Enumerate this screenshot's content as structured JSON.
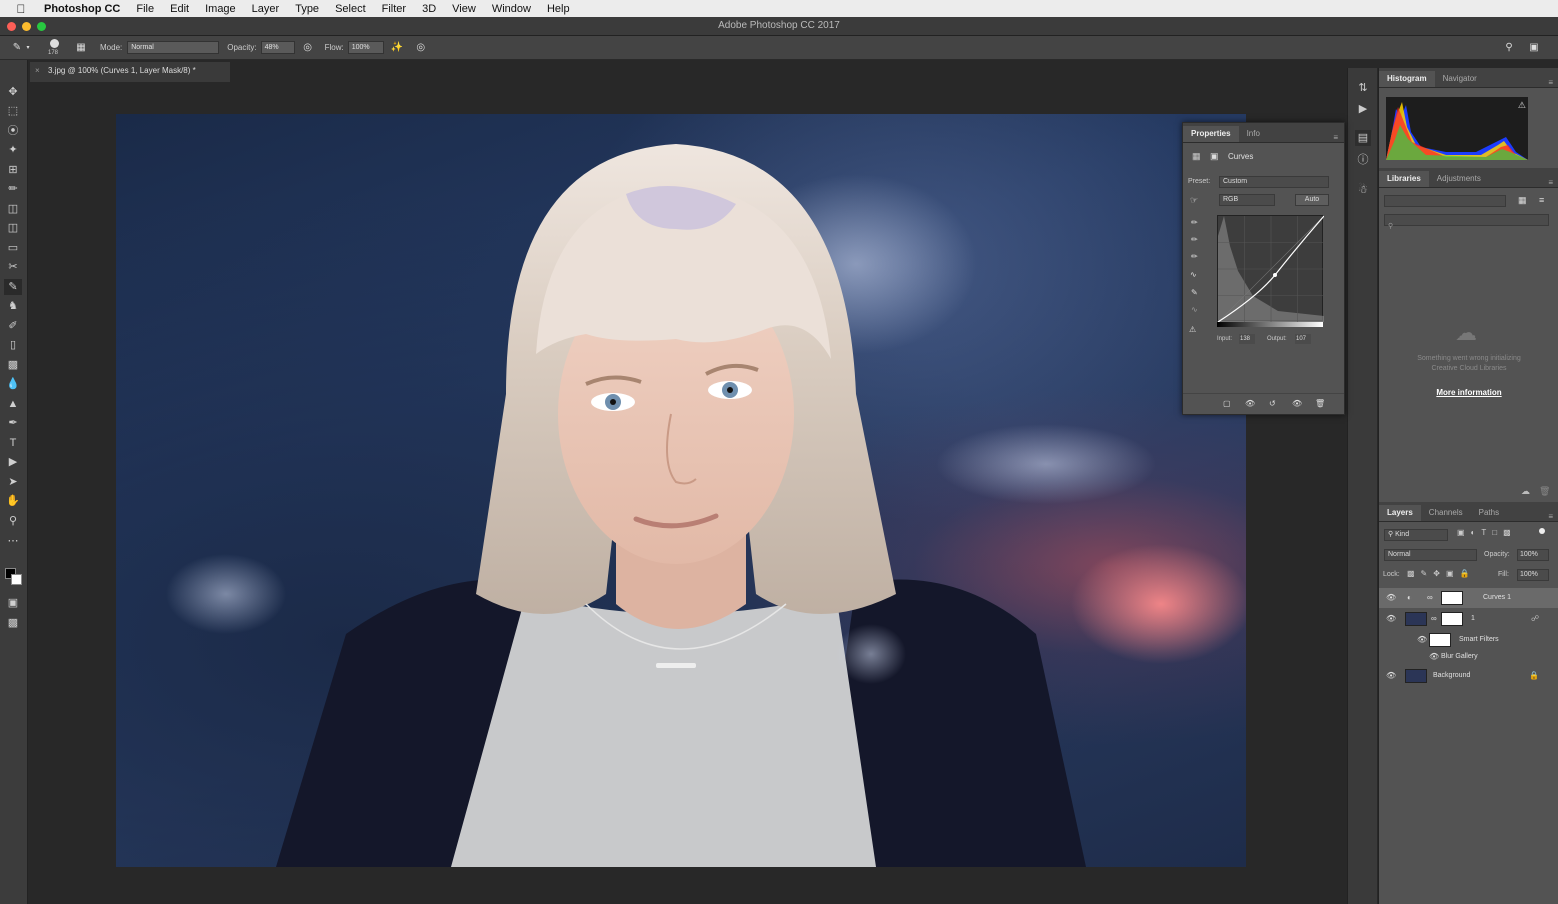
{
  "menubar": {
    "app": "Photoshop CC",
    "items": [
      "File",
      "Edit",
      "Image",
      "Layer",
      "Type",
      "Select",
      "Filter",
      "3D",
      "View",
      "Window",
      "Help"
    ]
  },
  "window": {
    "title": "Adobe Photoshop CC 2017"
  },
  "options_bar": {
    "brush_size": "178",
    "mode_label": "Mode:",
    "mode_value": "Normal",
    "opacity_label": "Opacity:",
    "opacity_value": "48%",
    "flow_label": "Flow:",
    "flow_value": "100%"
  },
  "document_tab": {
    "title": "3.jpg @ 100% (Curves 1, Layer Mask/8) *"
  },
  "histogram_panel": {
    "tabs": [
      "Histogram",
      "Navigator"
    ]
  },
  "libraries_panel": {
    "tabs": [
      "Libraries",
      "Adjustments"
    ],
    "error_line1": "Something went wrong initializing",
    "error_line2": "Creative Cloud Libraries",
    "more_info": "More information"
  },
  "properties_panel": {
    "tabs": [
      "Properties",
      "Info"
    ],
    "adjustment_name": "Curves",
    "preset_label": "Preset:",
    "preset_value": "Custom",
    "channel_value": "RGB",
    "auto_label": "Auto",
    "input_label": "Input:",
    "input_value": "138",
    "output_label": "Output:",
    "output_value": "107"
  },
  "layers_panel": {
    "tabs": [
      "Layers",
      "Channels",
      "Paths"
    ],
    "filter_value": "Kind",
    "blend_mode": "Normal",
    "opacity_label": "Opacity:",
    "opacity_value": "100%",
    "lock_label": "Lock:",
    "fill_label": "Fill:",
    "fill_value": "100%",
    "layers": [
      {
        "name": "Curves 1"
      },
      {
        "name": "1"
      },
      {
        "name": "Smart Filters"
      },
      {
        "name": "Blur Gallery"
      },
      {
        "name": "Background"
      }
    ]
  },
  "colors": {
    "menubar_bg": "#ececec",
    "panel_bg": "#535353",
    "canvas_bg": "#282828",
    "link_color": "#ffffff"
  }
}
